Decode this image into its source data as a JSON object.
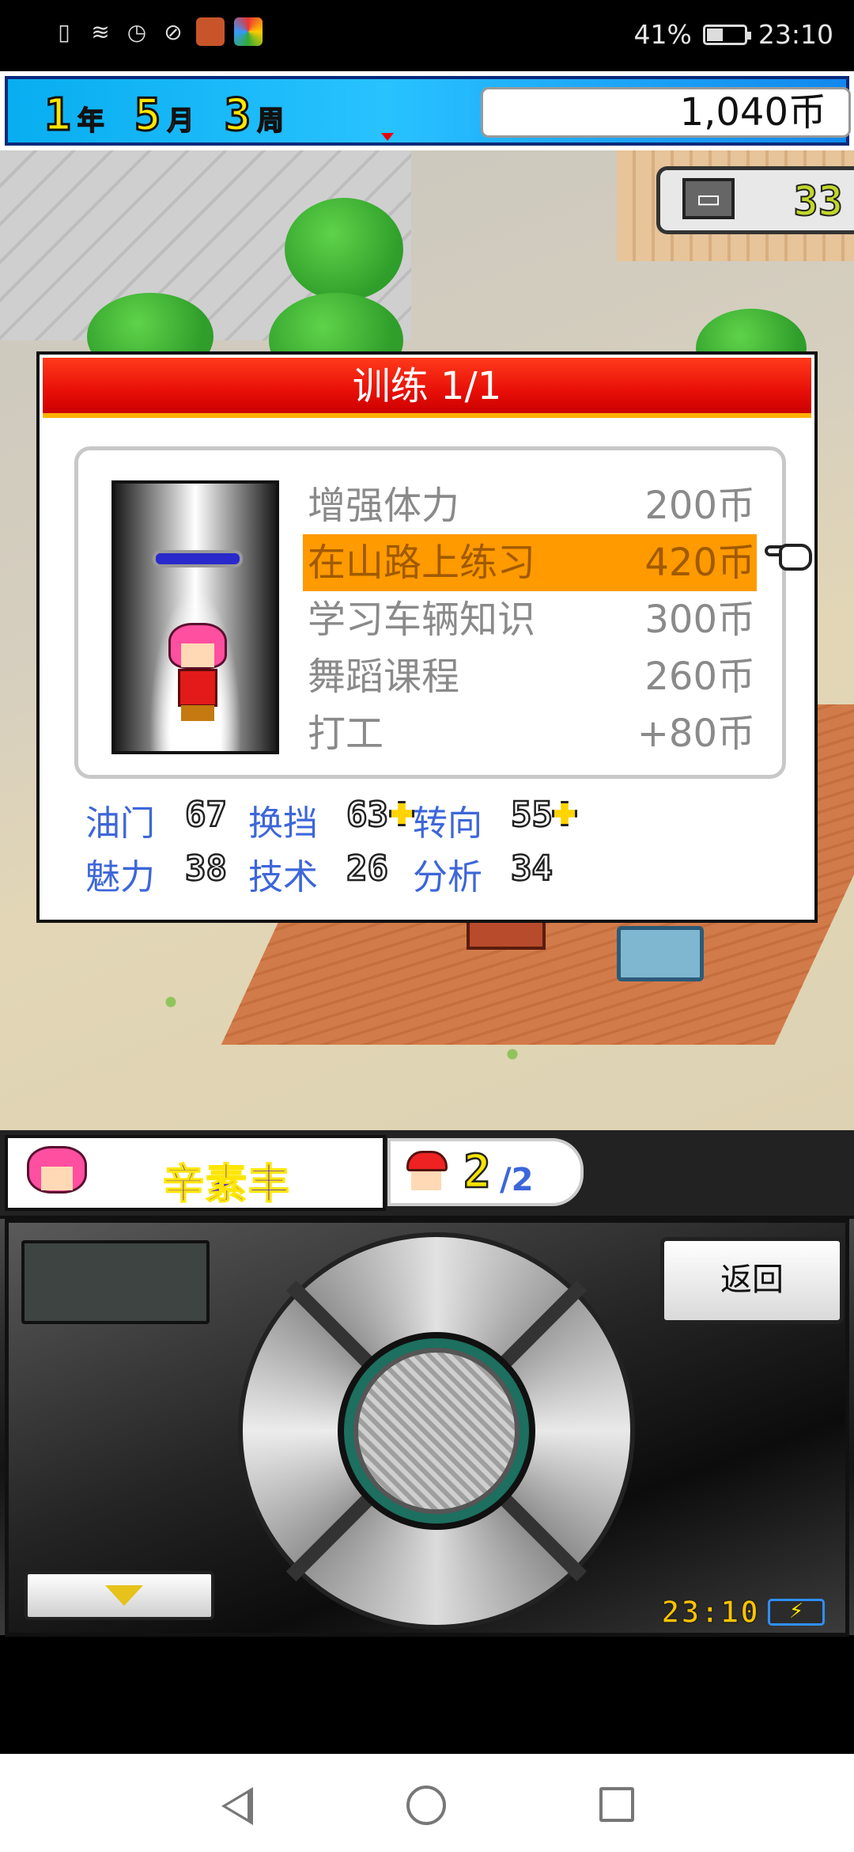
{
  "status_bar": {
    "battery_percent": "41%",
    "time": "23:10",
    "icons": [
      "notification-icon",
      "wifi-icon",
      "alarm-icon",
      "mute-icon",
      "game-app-icon",
      "browser-app-icon"
    ],
    "battery_level": 0.41
  },
  "top_bar": {
    "year": "1",
    "year_unit": "年",
    "month": "5",
    "month_unit": "月",
    "week": "3",
    "week_unit": "周",
    "money": "1,040币"
  },
  "scene": {
    "counter_value": "33"
  },
  "dialog": {
    "title": "训练 1/1",
    "options": [
      {
        "label": "增强体力",
        "price": "200币",
        "selected": false
      },
      {
        "label": "在山路上练习",
        "price": "420币",
        "selected": true
      },
      {
        "label": "学习车辆知识",
        "price": "300币",
        "selected": false
      },
      {
        "label": "舞蹈课程",
        "price": "260币",
        "selected": false
      },
      {
        "label": "打工",
        "price": "+80币",
        "selected": false
      }
    ],
    "stats": [
      {
        "label": "油门",
        "value": "67",
        "boost": false
      },
      {
        "label": "换挡",
        "value": "63",
        "boost": true
      },
      {
        "label": "转向",
        "value": "55",
        "boost": true
      },
      {
        "label": "魅力",
        "value": "38",
        "boost": false
      },
      {
        "label": "技术",
        "value": "26",
        "boost": false
      },
      {
        "label": "分析",
        "value": "34",
        "boost": false
      }
    ]
  },
  "character_bar": {
    "name": "辛素丰",
    "racer_count": "2",
    "racer_total": "/2"
  },
  "controller": {
    "back_label": "返回",
    "clock": "23:10"
  },
  "colors": {
    "dialog_header": "#e80f08",
    "selection": "#ff9a00",
    "stat_label": "#3d66d9",
    "topbar": "#28c2ff"
  }
}
